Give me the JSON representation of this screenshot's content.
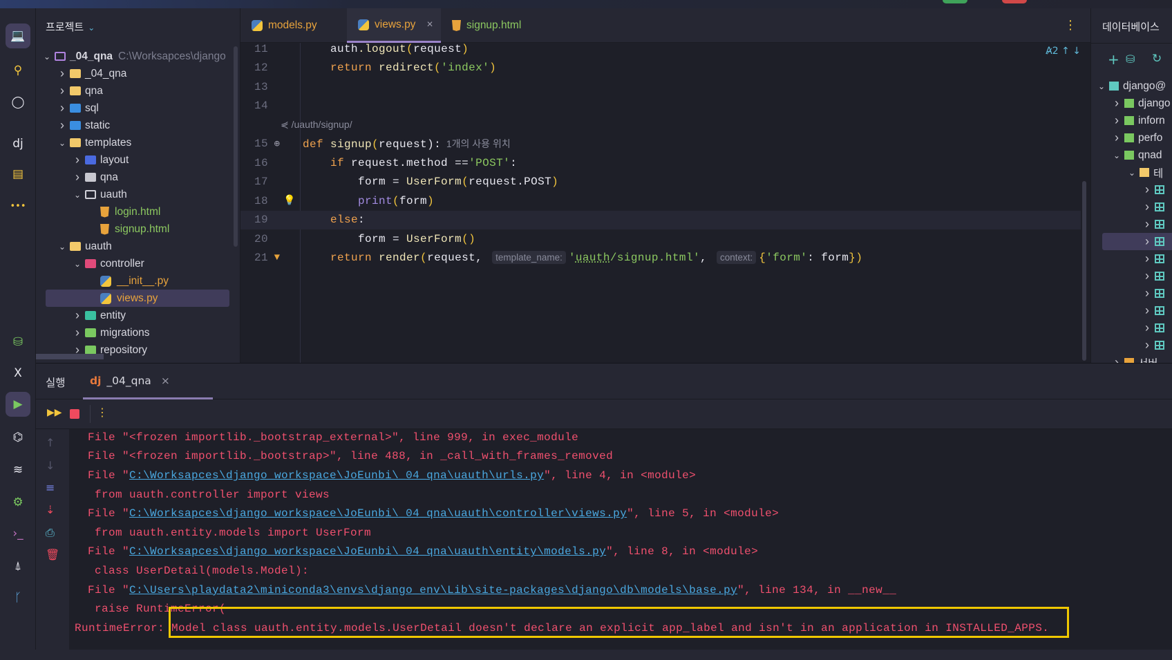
{
  "window": {
    "accent": "#9a83c9"
  },
  "activity_bar": [
    "project-icon",
    "commit-icon",
    "github-icon",
    "django-icon",
    "services-icon",
    "more-icon",
    "database-add-icon",
    "excel-icon",
    "run-icon",
    "python-console-icon",
    "layers-icon",
    "settings-icon",
    "terminal-icon",
    "notifications-icon",
    "git-branch-icon"
  ],
  "project": {
    "title": "프로젝트",
    "tree": [
      {
        "level": 0,
        "chev": "v",
        "icon": "folder-outline",
        "label": "_04_qna",
        "bold": true,
        "path": "C:\\Worksapces\\django"
      },
      {
        "level": 1,
        "chev": ">",
        "icon": "folder",
        "label": "_04_qna"
      },
      {
        "level": 1,
        "chev": ">",
        "icon": "folder",
        "label": "qna"
      },
      {
        "level": 1,
        "chev": ">",
        "icon": "folder-sql",
        "label": "sql"
      },
      {
        "level": 1,
        "chev": ">",
        "icon": "folder-web",
        "label": "static"
      },
      {
        "level": 1,
        "chev": "v",
        "icon": "folder-templates",
        "label": "templates"
      },
      {
        "level": 2,
        "chev": ">",
        "icon": "folder-layout",
        "label": "layout"
      },
      {
        "level": 2,
        "chev": ">",
        "icon": "folder-gray",
        "label": "qna"
      },
      {
        "level": 2,
        "chev": "v",
        "icon": "folder-outline-gray",
        "label": "uauth"
      },
      {
        "level": 3,
        "chev": "",
        "icon": "html",
        "label": "login.html",
        "color": "#8cc860"
      },
      {
        "level": 3,
        "chev": "",
        "icon": "html",
        "label": "signup.html",
        "color": "#8cc860"
      },
      {
        "level": 1,
        "chev": "v",
        "icon": "folder",
        "label": "uauth"
      },
      {
        "level": 2,
        "chev": "v",
        "icon": "folder-controller",
        "label": "controller"
      },
      {
        "level": 3,
        "chev": "",
        "icon": "python",
        "label": "__init__.py",
        "color": "#e8a33c"
      },
      {
        "level": 3,
        "chev": "",
        "icon": "python",
        "label": "views.py",
        "color": "#e8a33c",
        "selected": true
      },
      {
        "level": 2,
        "chev": ">",
        "icon": "folder-entity",
        "label": "entity"
      },
      {
        "level": 2,
        "chev": ">",
        "icon": "folder-migrations",
        "label": "migrations"
      },
      {
        "level": 2,
        "chev": ">",
        "icon": "folder-migrations",
        "label": "repository"
      }
    ]
  },
  "tabs": [
    {
      "label": "models.py",
      "icon": "python",
      "color": "#e8a33c"
    },
    {
      "label": "views.py",
      "icon": "python",
      "color": "#e8a33c",
      "active": true,
      "close": "×"
    },
    {
      "label": "signup.html",
      "icon": "html",
      "color": "#8cc860"
    }
  ],
  "editor": {
    "inspection": "2",
    "lines": [
      {
        "n": "11",
        "t": [
          [
            "    ",
            ""
          ],
          [
            "auth",
            "id"
          ],
          [
            ".logout",
            "fn"
          ],
          [
            "(",
            "br"
          ],
          [
            "request",
            "id"
          ],
          [
            ")",
            "br"
          ]
        ]
      },
      {
        "n": "12",
        "t": [
          [
            "    ",
            ""
          ],
          [
            "return ",
            "kw"
          ],
          [
            "redirect",
            "fn"
          ],
          [
            "(",
            "br"
          ],
          [
            "'index'",
            "st"
          ],
          [
            ")",
            "br"
          ]
        ]
      },
      {
        "n": "13",
        "t": []
      },
      {
        "n": "14",
        "t": []
      },
      {
        "n": "",
        "hint": "/uauth/signup/"
      },
      {
        "n": "15",
        "gi": "web-search-icon",
        "t": [
          [
            "def ",
            "kw"
          ],
          [
            "signup",
            "fn"
          ],
          [
            "(",
            "br"
          ],
          [
            "request",
            "id"
          ],
          [
            "):",
            "pu"
          ],
          [
            "  1개의 사용 위치",
            "cm"
          ]
        ]
      },
      {
        "n": "16",
        "t": [
          [
            "    ",
            ""
          ],
          [
            "if ",
            "kw"
          ],
          [
            "request.method ",
            "id"
          ],
          [
            "==",
            "pu"
          ],
          [
            "'POST'",
            "st"
          ],
          [
            ":",
            "pu"
          ]
        ]
      },
      {
        "n": "17",
        "t": [
          [
            "        ",
            ""
          ],
          [
            "form ",
            "id"
          ],
          [
            "= ",
            "pu"
          ],
          [
            "UserForm",
            "fn"
          ],
          [
            "(",
            "br"
          ],
          [
            "request.POST",
            "id"
          ],
          [
            ")",
            "br"
          ]
        ]
      },
      {
        "n": "18",
        "gi": "lightbulb-icon",
        "t": [
          [
            "        ",
            ""
          ],
          [
            "print",
            "bi"
          ],
          [
            "(",
            "br"
          ],
          [
            "form",
            "id"
          ],
          [
            ")",
            "br"
          ]
        ]
      },
      {
        "n": "19",
        "cur": true,
        "t": [
          [
            "    ",
            ""
          ],
          [
            "else",
            "kw"
          ],
          [
            ":",
            "pu"
          ]
        ]
      },
      {
        "n": "20",
        "t": [
          [
            "        ",
            ""
          ],
          [
            "form ",
            "id"
          ],
          [
            "= ",
            "pu"
          ],
          [
            "UserForm",
            "fn"
          ],
          [
            "()",
            "br"
          ]
        ]
      },
      {
        "n": "21",
        "gi": "html-icon",
        "t": [
          [
            "    ",
            ""
          ],
          [
            "return ",
            "kw"
          ],
          [
            "render",
            "fn"
          ],
          [
            "(",
            "br"
          ],
          [
            "request, ",
            "id"
          ],
          [
            "template_name:",
            "hint"
          ],
          [
            "'",
            "st"
          ],
          [
            "uauth",
            "st ul"
          ],
          [
            "/signup.html'",
            "st"
          ],
          [
            ", ",
            "pu"
          ],
          [
            "context:",
            "hint"
          ],
          [
            "{",
            "br"
          ],
          [
            "'form'",
            "st"
          ],
          [
            ": form",
            "id"
          ],
          [
            "}",
            "br"
          ],
          [
            ")",
            "br"
          ]
        ]
      }
    ]
  },
  "database": {
    "title": "데이터베이스",
    "tree": [
      {
        "level": 0,
        "chev": "v",
        "icon": "postgres",
        "label": "django@"
      },
      {
        "level": 1,
        "chev": ">",
        "icon": "schema",
        "label": "django"
      },
      {
        "level": 1,
        "chev": ">",
        "icon": "schema",
        "label": "inforn"
      },
      {
        "level": 1,
        "chev": ">",
        "icon": "schema",
        "label": "perfo"
      },
      {
        "level": 1,
        "chev": "v",
        "icon": "schema",
        "label": "qnad"
      },
      {
        "level": 2,
        "chev": "v",
        "icon": "folder",
        "label": "테"
      },
      {
        "level": 3,
        "chev": ">",
        "icon": "table",
        "label": ""
      },
      {
        "level": 3,
        "chev": ">",
        "icon": "table",
        "label": ""
      },
      {
        "level": 3,
        "chev": ">",
        "icon": "table",
        "label": ""
      },
      {
        "level": 3,
        "chev": ">",
        "icon": "table",
        "label": "",
        "selected": true
      },
      {
        "level": 3,
        "chev": ">",
        "icon": "table",
        "label": ""
      },
      {
        "level": 3,
        "chev": ">",
        "icon": "table",
        "label": ""
      },
      {
        "level": 3,
        "chev": ">",
        "icon": "table",
        "label": ""
      },
      {
        "level": 3,
        "chev": ">",
        "icon": "table",
        "label": ""
      },
      {
        "level": 3,
        "chev": ">",
        "icon": "table",
        "label": ""
      },
      {
        "level": 3,
        "chev": ">",
        "icon": "table",
        "label": ""
      },
      {
        "level": 1,
        "chev": ">",
        "icon": "folder-orange",
        "label": "서버"
      }
    ]
  },
  "run": {
    "tab_run": "실행",
    "tab_config": "_04_qna",
    "close": "×",
    "console": [
      {
        "indent": 0,
        "pre": "File \"<frozen importlib._bootstrap_external>\", line 999, in exec_module"
      },
      {
        "indent": 0,
        "pre": "File \"<frozen importlib._bootstrap>\", line 488, in _call_with_frames_removed"
      },
      {
        "indent": 0,
        "pre": "File \"",
        "link": "C:\\Worksapces\\django_workspace\\JoEunbi\\_04_qna\\uauth\\urls.py",
        "post": "\", line 4, in <module>"
      },
      {
        "indent": 1,
        "pre": "from uauth.controller import views"
      },
      {
        "indent": 0,
        "pre": "File \"",
        "link": "C:\\Worksapces\\django_workspace\\JoEunbi\\_04_qna\\uauth\\controller\\views.py",
        "post": "\", line 5, in <module>"
      },
      {
        "indent": 1,
        "pre": "from uauth.entity.models import UserForm"
      },
      {
        "indent": 0,
        "pre": "File \"",
        "link": "C:\\Worksapces\\django_workspace\\JoEunbi\\_04_qna\\uauth\\entity\\models.py",
        "post": "\", line 8, in <module>"
      },
      {
        "indent": 1,
        "pre": "class UserDetail(models.Model):"
      },
      {
        "indent": 0,
        "pre": "File \"",
        "link": "C:\\Users\\playdata2\\miniconda3\\envs\\django_env\\Lib\\site-packages\\django\\db\\models\\base.py",
        "post": "\", line 134, in __new__"
      },
      {
        "indent": 1,
        "pre": "raise RuntimeError("
      },
      {
        "indent": -1,
        "pre": "RuntimeError: Model class uauth.entity.models.UserDetail doesn't declare an explicit app_label and isn't in an application in INSTALLED_APPS."
      }
    ],
    "highlight_color": "#f0c800",
    "error_color": "#f0506e",
    "link_color": "#4aa8e0"
  }
}
